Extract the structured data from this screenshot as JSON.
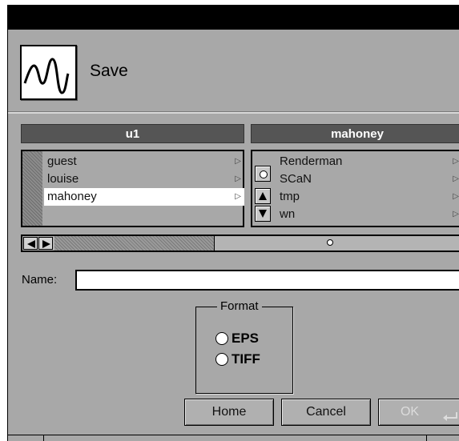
{
  "window": {
    "title": "Save"
  },
  "header": {
    "icon": "waveform-icon",
    "title": "Save"
  },
  "columns": {
    "left": {
      "header": "u1",
      "items": [
        {
          "label": "guest",
          "selected": false
        },
        {
          "label": "louise",
          "selected": false
        },
        {
          "label": "mahoney",
          "selected": true
        }
      ]
    },
    "right": {
      "header": "mahoney",
      "items": [
        {
          "label": "Renderman"
        },
        {
          "label": "SCaN"
        },
        {
          "label": "tmp"
        },
        {
          "label": "wn"
        }
      ]
    }
  },
  "name_field": {
    "label": "Name:",
    "value": "",
    "placeholder": ""
  },
  "format": {
    "legend": "Format",
    "options": [
      {
        "label": "EPS",
        "selected": false
      },
      {
        "label": "TIFF",
        "selected": false
      }
    ]
  },
  "buttons": {
    "home": "Home",
    "cancel": "Cancel",
    "ok": "OK"
  },
  "colors": {
    "panel": "#a8a8a8",
    "header_bar": "#555555",
    "selection": "#ffffff",
    "titlebar": "#000000"
  }
}
